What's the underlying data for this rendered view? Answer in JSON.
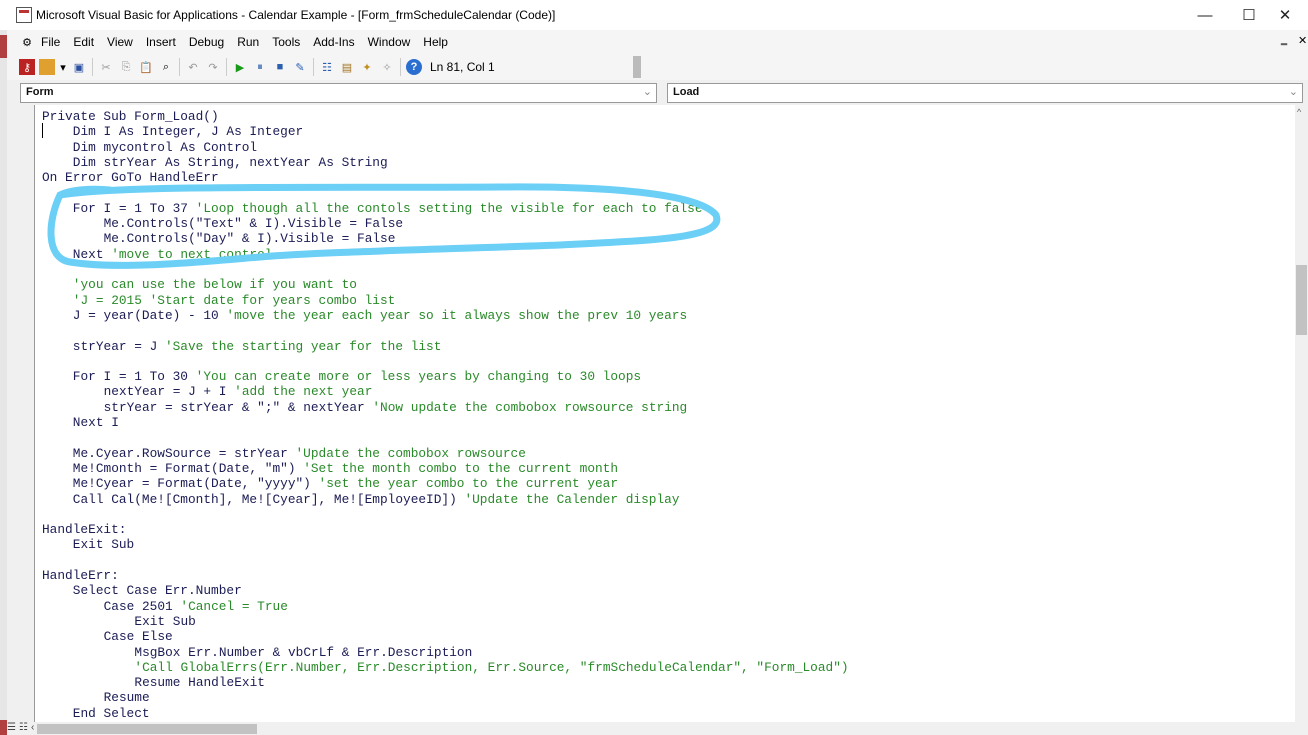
{
  "window": {
    "title": "Microsoft Visual Basic for Applications - Calendar Example - [Form_frmScheduleCalendar (Code)]",
    "minimize": "—",
    "maximize": "☐",
    "close": "✕"
  },
  "menu": [
    "File",
    "Edit",
    "View",
    "Insert",
    "Debug",
    "Run",
    "Tools",
    "Add-Ins",
    "Window",
    "Help"
  ],
  "mdi": {
    "minimize": "‗",
    "restore": "🗗",
    "close": "✕"
  },
  "toolbar": {
    "status": "Ln 81, Col 1"
  },
  "object_combo": "Form",
  "procedure_combo": "Load",
  "annotation_color": "#6ccff6",
  "code": [
    {
      "i": 0,
      "c": "Private Sub Form_Load()",
      "m": ""
    },
    {
      "i": 1,
      "c": "Dim I As Integer, J As Integer",
      "m": ""
    },
    {
      "i": 1,
      "c": "Dim mycontrol As Control",
      "m": ""
    },
    {
      "i": 1,
      "c": "Dim strYear As String, nextYear As String",
      "m": ""
    },
    {
      "i": 0,
      "c": "On Error GoTo HandleErr",
      "m": ""
    },
    {
      "i": 0,
      "c": "",
      "m": ""
    },
    {
      "i": 1,
      "c": "For I = 1 To 37 ",
      "m": "'Loop though all the contols setting the visible for each to false"
    },
    {
      "i": 2,
      "c": "Me.Controls(\"Text\" & I).Visible = False",
      "m": ""
    },
    {
      "i": 2,
      "c": "Me.Controls(\"Day\" & I).Visible = False",
      "m": ""
    },
    {
      "i": 1,
      "c": "Next ",
      "m": "'move to next control"
    },
    {
      "i": 0,
      "c": "",
      "m": ""
    },
    {
      "i": 1,
      "c": "",
      "m": "'you can use the below if you want to"
    },
    {
      "i": 1,
      "c": "",
      "m": "'J = 2015 'Start date for years combo list"
    },
    {
      "i": 1,
      "c": "J = year(Date) - 10 ",
      "m": "'move the year each year so it always show the prev 10 years"
    },
    {
      "i": 0,
      "c": "",
      "m": ""
    },
    {
      "i": 1,
      "c": "strYear = J ",
      "m": "'Save the starting year for the list"
    },
    {
      "i": 0,
      "c": "",
      "m": ""
    },
    {
      "i": 1,
      "c": "For I = 1 To 30 ",
      "m": "'You can create more or less years by changing to 30 loops"
    },
    {
      "i": 2,
      "c": "nextYear = J + I ",
      "m": "'add the next year"
    },
    {
      "i": 2,
      "c": "strYear = strYear & \";\" & nextYear ",
      "m": "'Now update the combobox rowsource string"
    },
    {
      "i": 1,
      "c": "Next I",
      "m": ""
    },
    {
      "i": 0,
      "c": "",
      "m": ""
    },
    {
      "i": 1,
      "c": "Me.Cyear.RowSource = strYear ",
      "m": "'Update the combobox rowsource"
    },
    {
      "i": 1,
      "c": "Me!Cmonth = Format(Date, \"m\") ",
      "m": "'Set the month combo to the current month"
    },
    {
      "i": 1,
      "c": "Me!Cyear = Format(Date, \"yyyy\") ",
      "m": "'set the year combo to the current year"
    },
    {
      "i": 1,
      "c": "Call Cal(Me![Cmonth], Me![Cyear], Me![EmployeeID]) ",
      "m": "'Update the Calender display"
    },
    {
      "i": 0,
      "c": "",
      "m": ""
    },
    {
      "i": 0,
      "c": "HandleExit:",
      "m": ""
    },
    {
      "i": 1,
      "c": "Exit Sub",
      "m": ""
    },
    {
      "i": 0,
      "c": "",
      "m": ""
    },
    {
      "i": 0,
      "c": "HandleErr:",
      "m": ""
    },
    {
      "i": 1,
      "c": "Select Case Err.Number",
      "m": ""
    },
    {
      "i": 2,
      "c": "Case 2501 ",
      "m": "'Cancel = True"
    },
    {
      "i": 3,
      "c": "Exit Sub",
      "m": ""
    },
    {
      "i": 2,
      "c": "Case Else",
      "m": ""
    },
    {
      "i": 3,
      "c": "MsgBox Err.Number & vbCrLf & Err.Description",
      "m": ""
    },
    {
      "i": 3,
      "c": "",
      "m": "'Call GlobalErrs(Err.Number, Err.Description, Err.Source, \"frmScheduleCalendar\", \"Form_Load\")"
    },
    {
      "i": 3,
      "c": "Resume HandleExit",
      "m": ""
    },
    {
      "i": 2,
      "c": "Resume",
      "m": ""
    },
    {
      "i": 1,
      "c": "End Select",
      "m": ""
    }
  ]
}
